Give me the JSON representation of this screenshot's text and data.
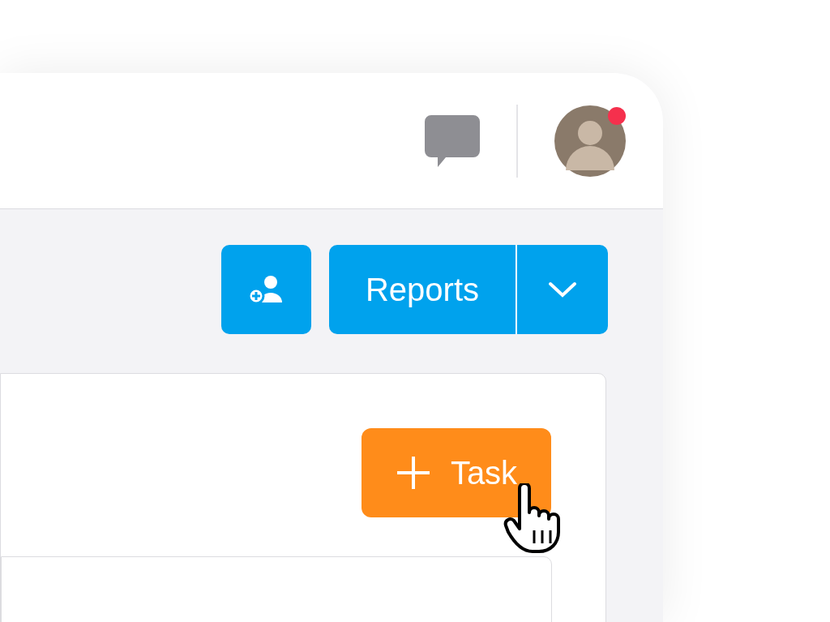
{
  "header": {
    "avatar": {
      "notification": true
    }
  },
  "toolbar": {
    "reports_button": {
      "label": "Reports"
    }
  },
  "panel": {
    "task_button": {
      "label": "Task"
    }
  }
}
